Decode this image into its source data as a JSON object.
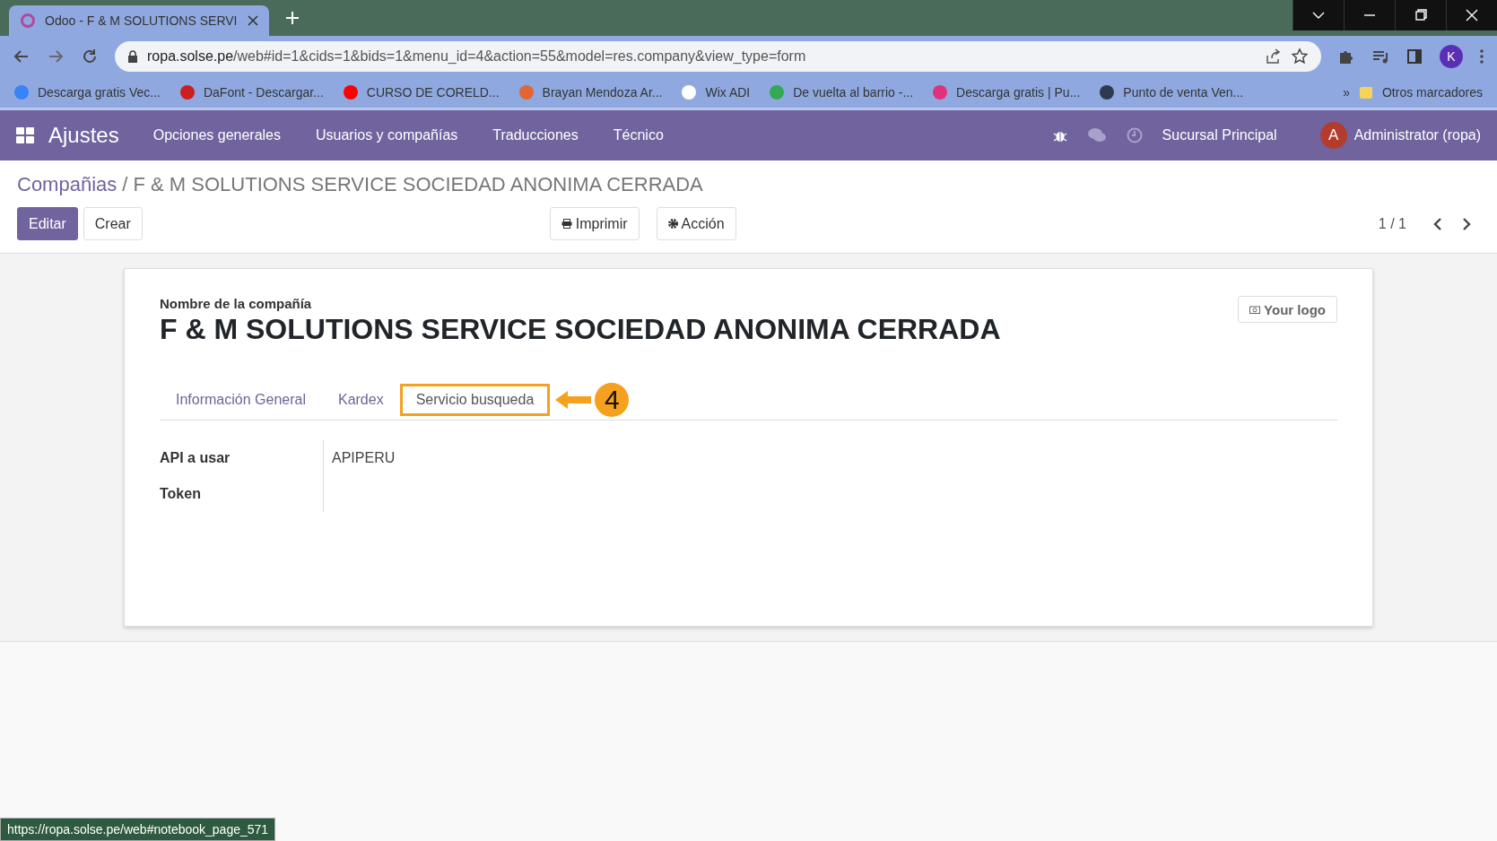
{
  "browser": {
    "tab_title": "Odoo - F & M SOLUTIONS SERVI",
    "url_host": "ropa.solse.pe",
    "url_path": "/web#id=1&cids=1&bids=1&menu_id=4&action=55&model=res.company&view_type=form",
    "profile_initial": "K",
    "bookmarks": [
      {
        "label": "Descarga gratis Vec...",
        "color": "#3b82f6"
      },
      {
        "label": "DaFont - Descargar...",
        "color": "#cc1f1f"
      },
      {
        "label": "CURSO DE CORELD...",
        "color": "#ff0000"
      },
      {
        "label": "Brayan Mendoza Ar...",
        "color": "#e2662f"
      },
      {
        "label": "Wix ADI",
        "color": "#ffffff"
      },
      {
        "label": "De vuelta al barrio -...",
        "color": "#34a853"
      },
      {
        "label": "Descarga gratis | Pu...",
        "color": "#e0327a"
      },
      {
        "label": "Punto de venta Ven...",
        "color": "#2e3a4f"
      }
    ],
    "more": "»",
    "other_bookmarks": "Otros marcadores"
  },
  "navbar": {
    "app": "Ajustes",
    "menu": [
      "Opciones generales",
      "Usuarios y compañías",
      "Traducciones",
      "Técnico"
    ],
    "branch": "Sucursal Principal",
    "user_initial": "A",
    "user": "Administrator (ropa)"
  },
  "breadcrumb": {
    "parent": "Compañias",
    "current": "/ F & M SOLUTIONS SERVICE SOCIEDAD ANONIMA CERRADA"
  },
  "actions": {
    "edit": "Editar",
    "create": "Crear",
    "print": "Imprimir",
    "action": "Acción",
    "pager": "1 / 1"
  },
  "form": {
    "name_label": "Nombre de la compañía",
    "name": "F & M SOLUTIONS SERVICE SOCIEDAD ANONIMA CERRADA",
    "logo_button": "Your logo",
    "tabs": [
      {
        "label": "Información General",
        "selected": false,
        "highlighted": false
      },
      {
        "label": "Kardex",
        "selected": false,
        "highlighted": false
      },
      {
        "label": "Servicio busqueda",
        "selected": true,
        "highlighted": true
      }
    ],
    "step_marker": "4",
    "fields": [
      {
        "label": "API a usar",
        "value": "APIPERU"
      },
      {
        "label": "Token"
      }
    ]
  },
  "status_bar": "https://ropa.solse.pe/web#notebook_page_571"
}
